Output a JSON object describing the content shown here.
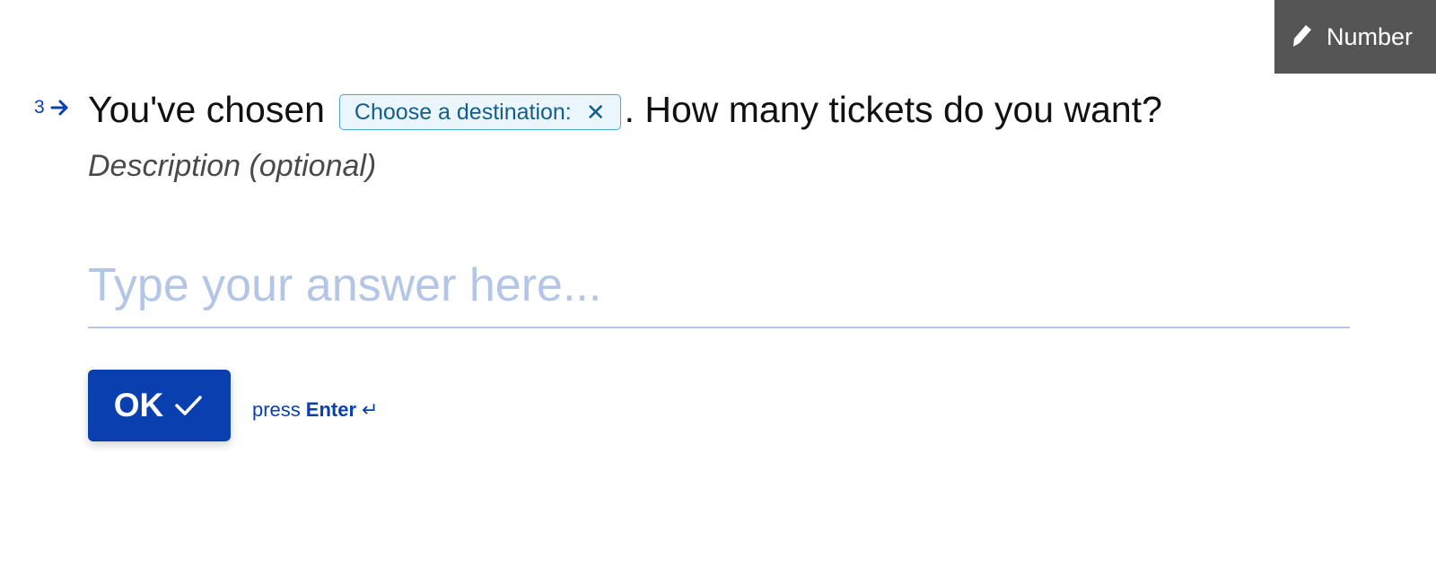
{
  "badge": {
    "icon": "pencil-icon",
    "label": "Number"
  },
  "question": {
    "number": "3",
    "arrow_icon": "arrow-right-icon",
    "text_before": "You've chosen",
    "chip_label": "Choose a destination:",
    "chip_remove_icon": "close-icon",
    "text_after": ". How many tickets do you want?",
    "description": "Description (optional)"
  },
  "answer": {
    "placeholder": "Type your answer here...",
    "value": ""
  },
  "actions": {
    "ok_label": "OK",
    "ok_icon": "check-icon",
    "hint_prefix": "press",
    "hint_key": "Enter",
    "hint_icon_glyph": "↵"
  },
  "colors": {
    "accent": "#0a3fb0",
    "badge_bg": "#555555",
    "chip_border": "#4aa6d8",
    "chip_bg": "#eaf5fc",
    "placeholder": "#b4c6e6"
  }
}
